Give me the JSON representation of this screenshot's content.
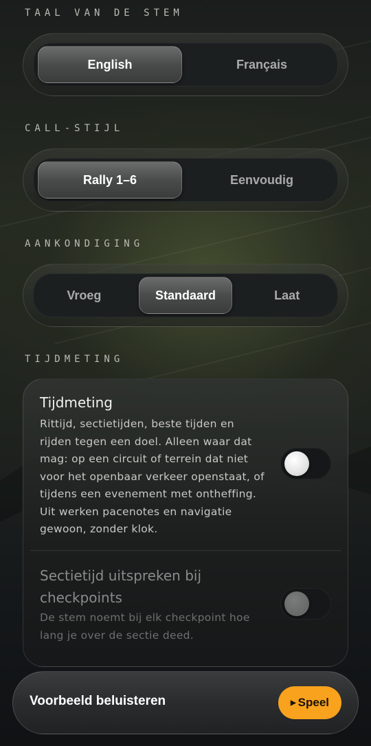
{
  "voice_language": {
    "label": "TAAL VAN DE STEM",
    "options": [
      "English",
      "Français"
    ],
    "selected": "English"
  },
  "call_style": {
    "label": "CALL-STIJL",
    "options": [
      "Rally 1–6",
      "Eenvoudig"
    ],
    "selected": "Rally 1–6"
  },
  "announcement": {
    "label": "AANKONDIGING",
    "options": [
      "Vroeg",
      "Standaard",
      "Laat"
    ],
    "selected": "Standaard"
  },
  "timing": {
    "label": "TIJDMETING",
    "main": {
      "title": "Tijdmeting",
      "description": "Rittijd, sectietijden, beste tijden en rijden tegen een doel. Alleen waar dat mag: op een circuit of terrein dat niet voor het openbaar verkeer openstaat, of tijdens een evenement met ontheffing. Uit werken pacenotes en navigatie gewoon, zonder klok.",
      "enabled": false
    },
    "checkpoint": {
      "title": "Sectietijd uitspreken bij checkpoints",
      "description": "De stem noemt bij elk checkpoint hoe lang je over de sectie deed.",
      "enabled": false,
      "disabled": true
    }
  },
  "preview": {
    "label": "Voorbeeld beluisteren",
    "play_icon": "play-triangle-icon",
    "play_label": "Speel"
  },
  "colors": {
    "accent": "#f8a21e",
    "background": "#14171a"
  }
}
